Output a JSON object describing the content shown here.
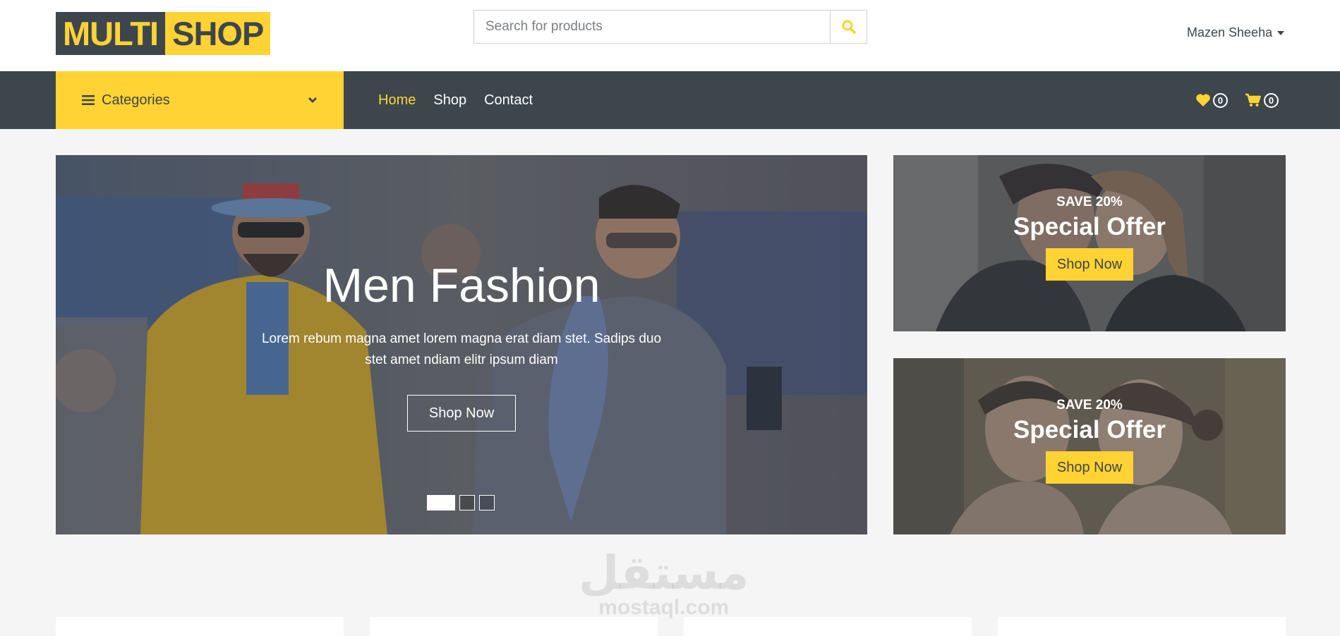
{
  "header": {
    "logo_part1": "MULTI",
    "logo_part2": "SHOP",
    "search_placeholder": "Search for products",
    "user_name": "Mazen Sheeha"
  },
  "nav": {
    "categories_label": "Categories",
    "links": [
      {
        "label": "Home",
        "active": true
      },
      {
        "label": "Shop",
        "active": false
      },
      {
        "label": "Contact",
        "active": false
      }
    ],
    "wishlist_count": "0",
    "cart_count": "0"
  },
  "hero": {
    "title": "Men Fashion",
    "description": "Lorem rebum magna amet lorem magna erat diam stet. Sadips duo stet amet ndiam elitr ipsum diam",
    "button_label": "Shop Now",
    "slide_count": 3,
    "active_slide": 1
  },
  "offers": [
    {
      "save_label": "SAVE 20%",
      "title": "Special Offer",
      "button_label": "Shop Now"
    },
    {
      "save_label": "SAVE 20%",
      "title": "Special Offer",
      "button_label": "Shop Now"
    }
  ],
  "watermark": {
    "arabic": "مستقل",
    "latin": "mostaql.com"
  },
  "colors": {
    "accent": "#ffd333",
    "dark": "#3d464d",
    "background": "#f5f5f5"
  }
}
